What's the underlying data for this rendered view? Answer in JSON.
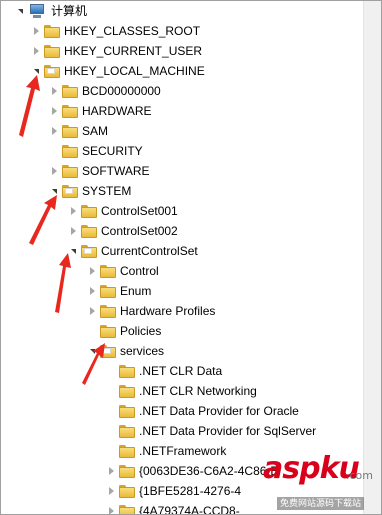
{
  "tree": {
    "root": {
      "label": "计算机",
      "icon": "computer-icon"
    },
    "nodes": [
      {
        "label": "HKEY_CLASSES_ROOT",
        "state": "collapsed",
        "icon": "folder-icon"
      },
      {
        "label": "HKEY_CURRENT_USER",
        "state": "collapsed",
        "icon": "folder-icon"
      },
      {
        "label": "HKEY_LOCAL_MACHINE",
        "state": "expanded",
        "icon": "folder-icon"
      },
      {
        "label": "BCD00000000",
        "state": "collapsed",
        "icon": "folder-icon"
      },
      {
        "label": "HARDWARE",
        "state": "collapsed",
        "icon": "folder-icon"
      },
      {
        "label": "SAM",
        "state": "collapsed",
        "icon": "folder-icon"
      },
      {
        "label": "SECURITY",
        "state": "leaf",
        "icon": "folder-icon"
      },
      {
        "label": "SOFTWARE",
        "state": "collapsed",
        "icon": "folder-icon"
      },
      {
        "label": "SYSTEM",
        "state": "expanded",
        "icon": "folder-icon"
      },
      {
        "label": "ControlSet001",
        "state": "collapsed",
        "icon": "folder-icon"
      },
      {
        "label": "ControlSet002",
        "state": "collapsed",
        "icon": "folder-icon"
      },
      {
        "label": "CurrentControlSet",
        "state": "expanded",
        "icon": "folder-icon"
      },
      {
        "label": "Control",
        "state": "collapsed",
        "icon": "folder-icon"
      },
      {
        "label": "Enum",
        "state": "collapsed",
        "icon": "folder-icon"
      },
      {
        "label": "Hardware Profiles",
        "state": "collapsed",
        "icon": "folder-icon"
      },
      {
        "label": "Policies",
        "state": "leaf",
        "icon": "folder-icon"
      },
      {
        "label": "services",
        "state": "expanded",
        "icon": "folder-icon"
      },
      {
        "label": ".NET CLR Data",
        "state": "leaf",
        "icon": "folder-icon"
      },
      {
        "label": ".NET CLR Networking",
        "state": "leaf",
        "icon": "folder-icon"
      },
      {
        "label": ".NET Data Provider for Oracle",
        "state": "leaf",
        "icon": "folder-icon"
      },
      {
        "label": ".NET Data Provider for SqlServer",
        "state": "leaf",
        "icon": "folder-icon"
      },
      {
        "label": ".NETFramework",
        "state": "leaf",
        "icon": "folder-icon"
      },
      {
        "label": "{0063DE36-C6A2-4C86-E",
        "state": "collapsed",
        "icon": "folder-icon"
      },
      {
        "label": "{1BFE5281-4276-4",
        "state": "collapsed",
        "icon": "folder-icon"
      },
      {
        "label": "{4A79374A-CCD8-",
        "state": "collapsed",
        "icon": "folder-icon"
      }
    ]
  },
  "watermark": {
    "main": "aspku",
    "suffix": ".com",
    "sub": "免费网站源码下载站"
  },
  "colors": {
    "arrow": "#e8281e",
    "watermark": "#d9001b"
  }
}
